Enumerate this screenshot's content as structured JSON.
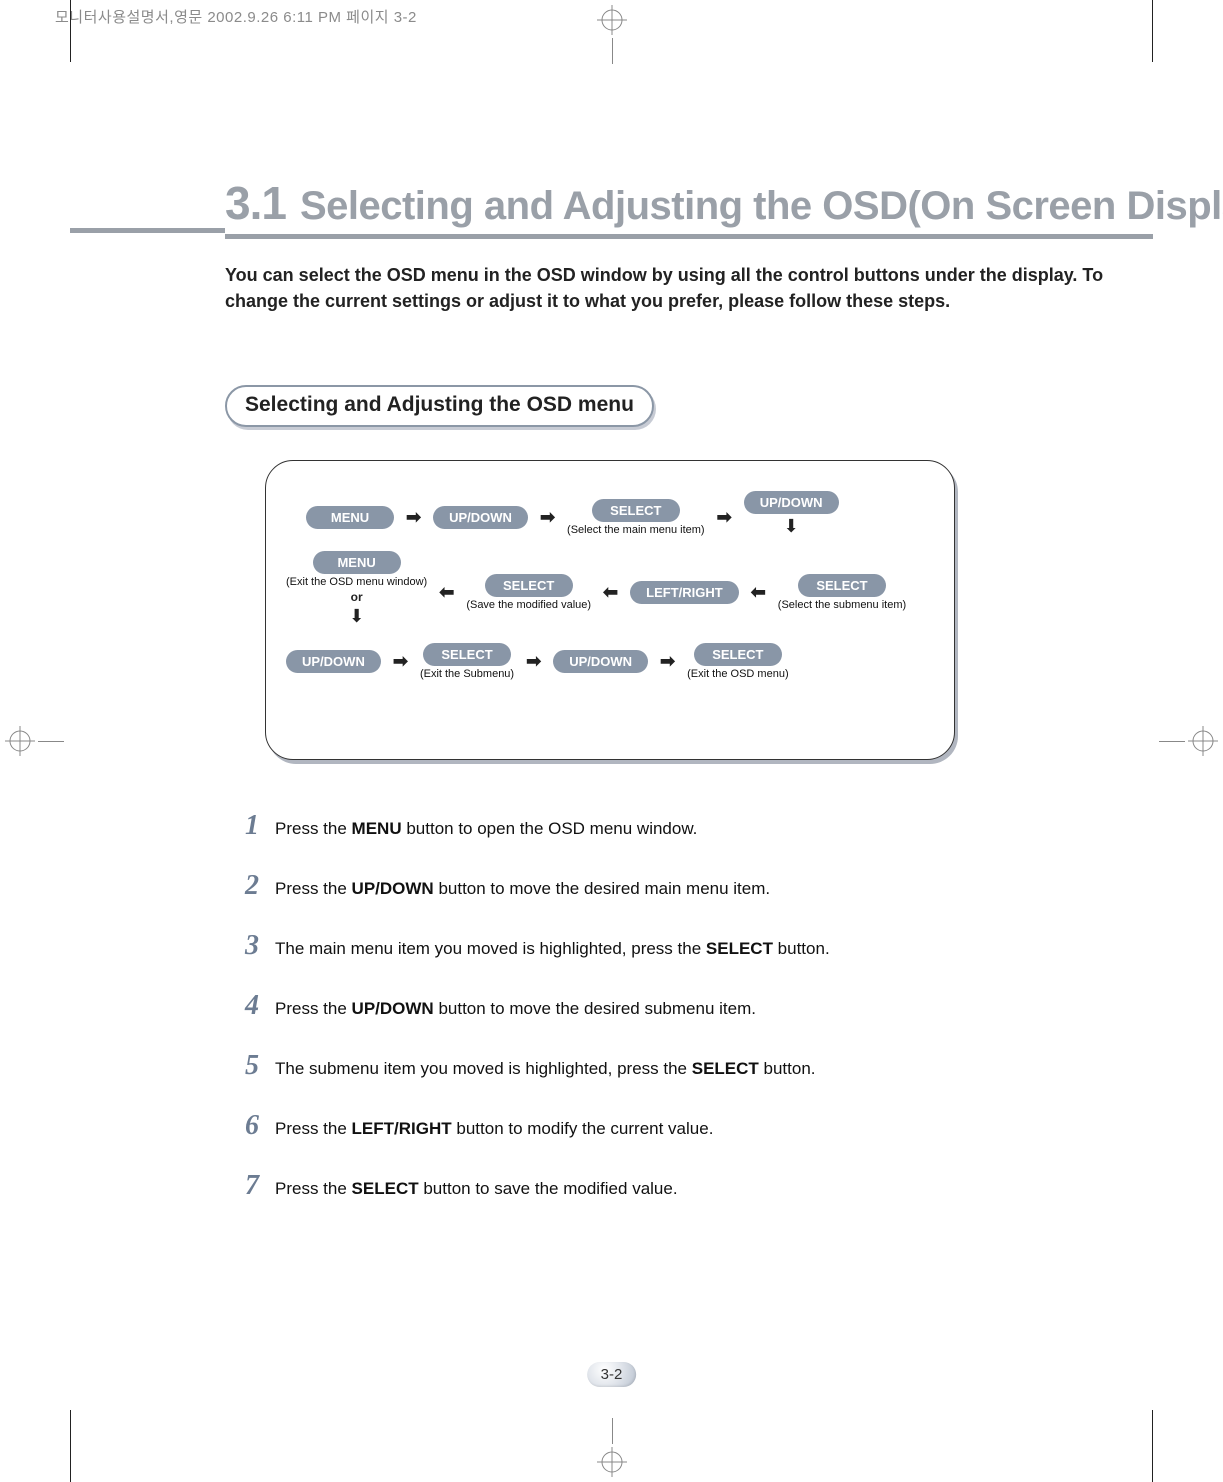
{
  "header_strip": "모니터사용설명서,영문  2002.9.26 6:11 PM  페이지 3-2",
  "section": {
    "number": "3.1",
    "title": "Selecting and Adjusting the OSD(On Screen Display) Menu"
  },
  "intro": "You can select the OSD menu in the OSD window by using all the control buttons under the display. To change the current settings or adjust it to what you prefer, please follow these steps.",
  "subheading": "Selecting and Adjusting the OSD menu",
  "flow": {
    "row1": {
      "p1": "MENU",
      "p2": "UP/DOWN",
      "p3": "SELECT",
      "p3_cap": "(Select the main menu item)",
      "p4": "UP/DOWN"
    },
    "row2": {
      "p1": "MENU",
      "p1_cap": "(Exit the OSD menu window)",
      "p1_or": "or",
      "p2": "SELECT",
      "p2_cap": "(Save the modified value)",
      "p3": "LEFT/RIGHT",
      "p4": "SELECT",
      "p4_cap": "(Select the submenu item)"
    },
    "row3": {
      "p1": "UP/DOWN",
      "p2": "SELECT",
      "p2_cap": "(Exit the Submenu)",
      "p3": "UP/DOWN",
      "p4": "SELECT",
      "p4_cap": "(Exit the OSD menu)"
    }
  },
  "steps": [
    {
      "n": "1",
      "pre": "Press the ",
      "bold": "MENU",
      "post": " button to open the OSD menu window."
    },
    {
      "n": "2",
      "pre": "Press the ",
      "bold": "UP/DOWN",
      "post": " button to move the desired main menu item."
    },
    {
      "n": "3",
      "pre": "The main menu item you moved is highlighted, press the ",
      "bold": "SELECT",
      "post": " button."
    },
    {
      "n": "4",
      "pre": "Press the ",
      "bold": "UP/DOWN",
      "post": " button to move the desired submenu item."
    },
    {
      "n": "5",
      "pre": "The submenu item you moved is highlighted, press the ",
      "bold": "SELECT",
      "post": " button."
    },
    {
      "n": "6",
      "pre": "Press the ",
      "bold": "LEFT/RIGHT",
      "post": " button to modify the current value."
    },
    {
      "n": "7",
      "pre": "Press the ",
      "bold": "SELECT",
      "post": " button to save the modified value."
    }
  ],
  "page_number": "3-2"
}
